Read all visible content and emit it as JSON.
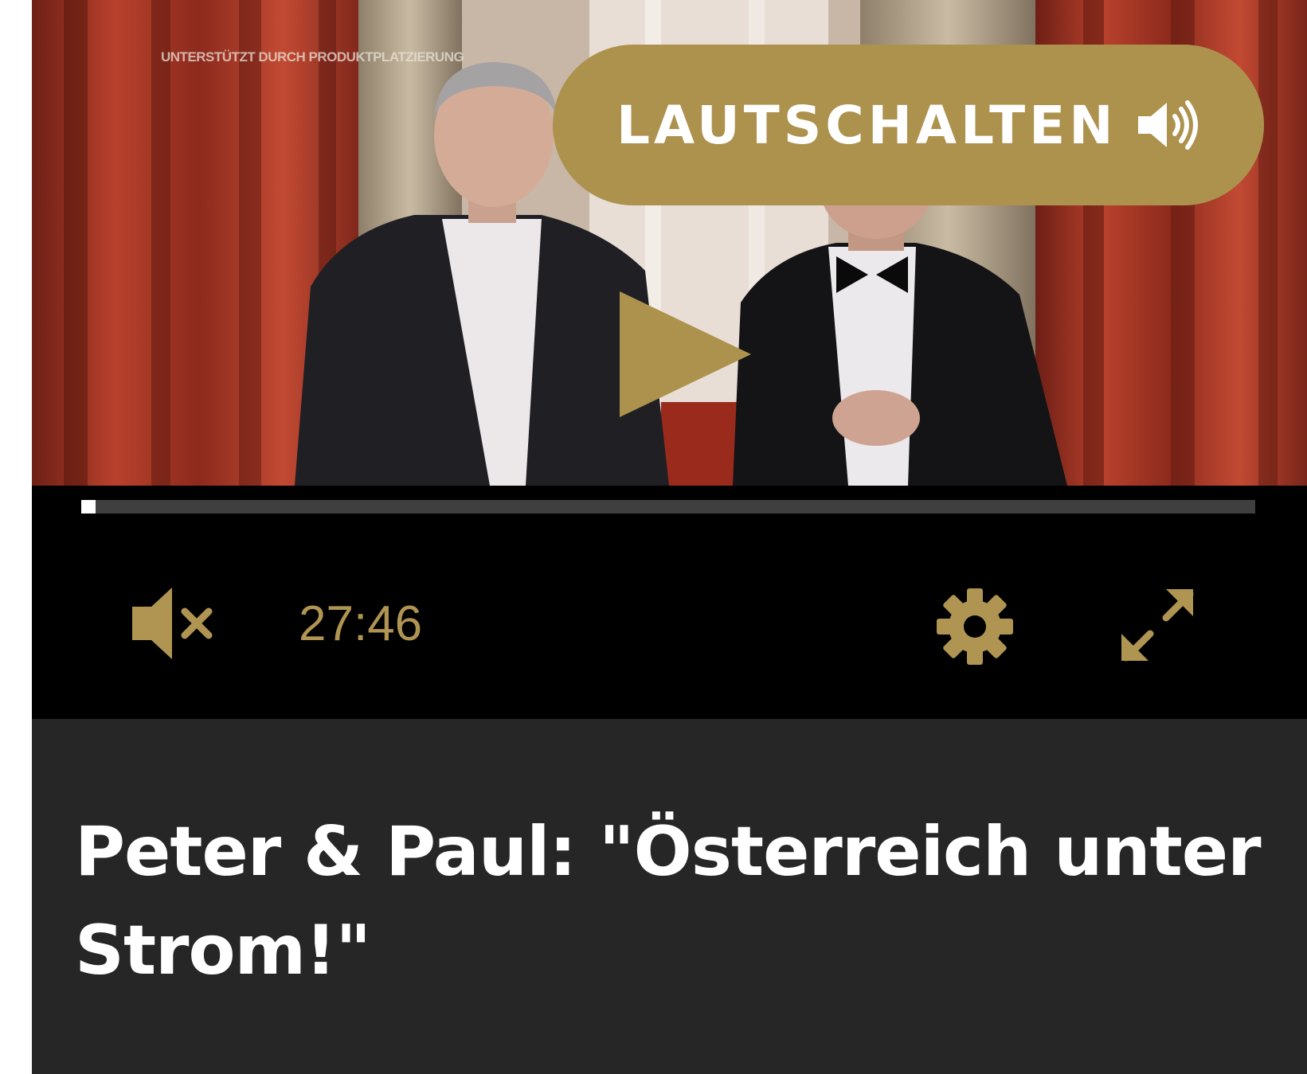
{
  "video": {
    "watermark": "UNTERSTÜTZT DURCH PRODUKTPLATZIERUNG",
    "unmute_label": "LAUTSCHALTEN",
    "unmute_icon": "speaker-volume-icon",
    "play_icon": "play-icon"
  },
  "controls": {
    "progress_fraction": 0.012,
    "mute_icon": "speaker-muted-icon",
    "time": "27:46",
    "settings_icon": "gear-icon",
    "fullscreen_icon": "fullscreen-expand-icon"
  },
  "caption": {
    "title": "Peter & Paul: \"Österreich unter Strom!\""
  },
  "colors": {
    "accent_gold": "#ad924e",
    "control_gold": "#b09552",
    "bar_black": "#000000",
    "caption_bg": "#262626",
    "progress_track": "#3f3f3f",
    "progress_fill": "#ffffff"
  }
}
